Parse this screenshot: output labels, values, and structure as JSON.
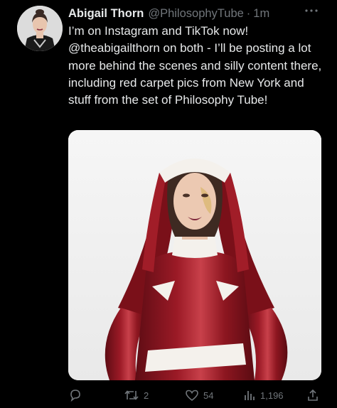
{
  "tweet": {
    "author": {
      "display_name": "Abigail Thorn",
      "handle": "@PhilosophyTube",
      "separator": "·",
      "time": "1m"
    },
    "text": "I’m on Instagram and TikTok now! @theabigailthorn on both - I’ll be posting a lot more behind the scenes and silly content there, including red carpet pics from New York and stuff from the set of Philosophy Tube!"
  },
  "actions": {
    "reply": {
      "icon": "reply-icon"
    },
    "retweet": {
      "icon": "retweet-icon",
      "count": "2"
    },
    "like": {
      "icon": "heart-icon",
      "count": "54"
    },
    "views": {
      "icon": "views-icon",
      "count": "1,196"
    },
    "share": {
      "icon": "share-icon"
    }
  },
  "colors": {
    "background": "#000000",
    "text": "#e7e9ea",
    "muted": "#71767b",
    "latex_red": "#8a1620"
  }
}
